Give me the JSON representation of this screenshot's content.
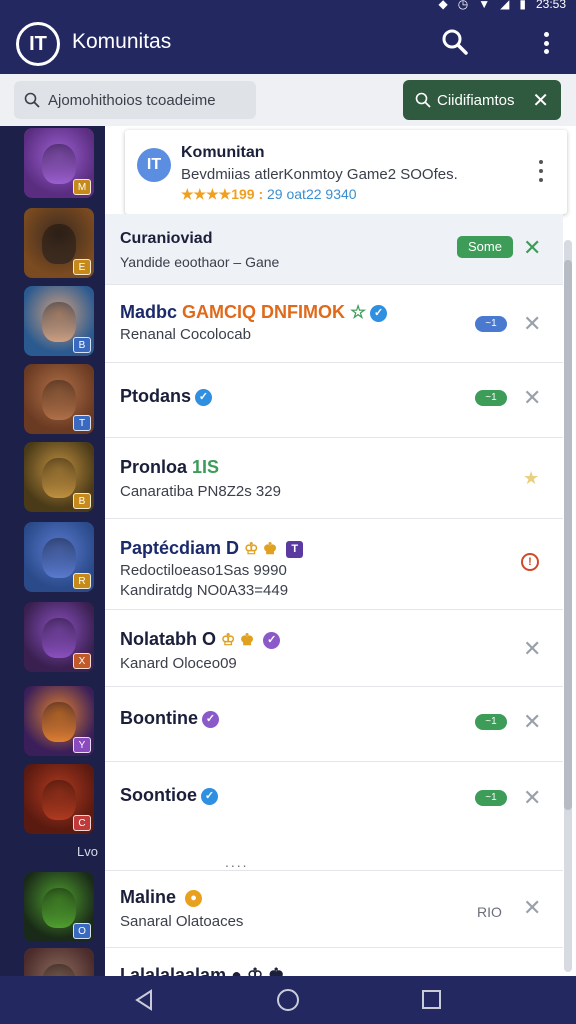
{
  "status_bar": {
    "time": "23:53"
  },
  "app_bar": {
    "logo_text": "IT",
    "title": "Komunitas"
  },
  "search": {
    "placeholder": "Ajomohithoios tcoadeime"
  },
  "filter_chip": {
    "label": "Ciidifiamtos"
  },
  "sidebar": {
    "last_label": "Lvo",
    "thumbnails": [
      {
        "badge": "M",
        "bg": "#5a2d80",
        "face": "#9b5fd0",
        "badge_color": "#c58a1a"
      },
      {
        "badge": "E",
        "bg": "#7a4a20",
        "face": "#3a2a20",
        "badge_color": "#c58a1a"
      },
      {
        "badge": "B",
        "bg": "#2a5a90",
        "face": "#d0a080",
        "badge_color": "#3a6ac0"
      },
      {
        "badge": "T",
        "bg": "#6a3a22",
        "face": "#b07048",
        "badge_color": "#3a6ac0"
      },
      {
        "badge": "B",
        "bg": "#4a3a18",
        "face": "#c09040",
        "badge_color": "#c58a1a"
      },
      {
        "badge": "R",
        "bg": "#2a4a8a",
        "face": "#5a7ad0",
        "badge_color": "#c58a1a"
      },
      {
        "badge": "X",
        "bg": "#3a2050",
        "face": "#8a50c0",
        "badge_color": "#c05a2a"
      },
      {
        "badge": "Y",
        "bg": "#3a1f5a",
        "face": "#e08030",
        "badge_color": "#8a4ac0"
      },
      {
        "badge": "C",
        "bg": "#5a1a10",
        "face": "#b03a20",
        "badge_color": "#c03a3a"
      },
      {
        "badge": "O",
        "bg": "#1a2a18",
        "face": "#50a030",
        "badge_color": "#3a6ac0"
      },
      {
        "badge": "S",
        "bg": "#4a2a2a",
        "face": "#8a6a5a",
        "badge_color": "#c58a1a"
      }
    ]
  },
  "card": {
    "icon_text": "IT",
    "title": "Komunitan",
    "subtitle": "Bevdmiias atlerKonmtoy Game2 SOOfes.",
    "stars": "★★★★",
    "rating_text": "199 :",
    "rating_extra": "29 oat22 9340"
  },
  "rows": [
    {
      "name": "Curanioviad",
      "sub": "Yandide eoothaor – Gane",
      "badge": "Some",
      "active": true
    },
    {
      "name_a": "Madbc ",
      "name_b": "GAMCIQ DNFIMOK",
      "name_c": " ☆",
      "sub": "Renanal Cocolocab",
      "pill": "~1",
      "pill_color": "#4a7ad0",
      "verified_color": "#2f8fe0"
    },
    {
      "name": "Ptodans",
      "pill": "~1",
      "pill_color": "#3c9c58",
      "verified_color": "#2f8fe0"
    },
    {
      "name_a": "Pronloa ",
      "name_b": "1IS",
      "sub": "Canaratiba PN8Z2s 329",
      "star": "★"
    },
    {
      "name": "Paptécdiam D",
      "icons": "♔ ♚",
      "sub": "Redoctiloeaso1Sas 9990",
      "sub2": "Kandiratdg NO0A33=449",
      "alert": "!"
    },
    {
      "name": "Nolatabh O",
      "icons": "♔ ♚",
      "sub": "Kanard Oloceo09"
    },
    {
      "name": "Boontine",
      "pill": "~1",
      "pill_color": "#3c9c58",
      "verified_color": "#8a5ac8"
    },
    {
      "name": "Soontioe",
      "pill": "~1",
      "pill_color": "#3c9c58",
      "verified_color": "#2f8fe0"
    },
    {
      "name": "Maline",
      "sub": "Sanaral Olatoaces",
      "tag": "RIO"
    },
    {
      "name": "I alalalaalam ● ♔ ♚"
    }
  ],
  "ellipsis": "....",
  "nav": {
    "back": "back",
    "home": "home",
    "recent": "recent"
  }
}
